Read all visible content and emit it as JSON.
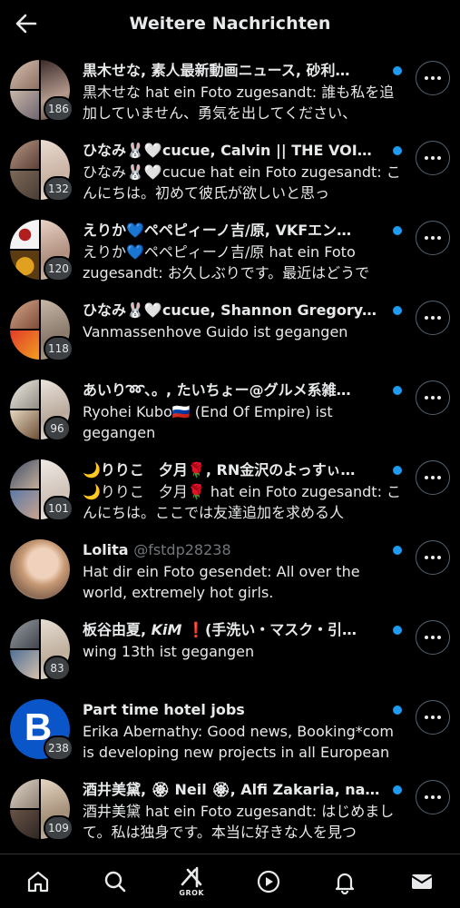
{
  "header": {
    "title": "Weitere Nachrichten"
  },
  "conversations": [
    {
      "title": "黒木せな, 素人最新動画ニュース, 砂利…",
      "handle": "",
      "preview": "黒木せな hat ein Foto zugesandt: 誰も私を追加していません、勇気を出してください、",
      "count": "186",
      "unread": true
    },
    {
      "title": "ひなみ🐰🤍cucue, Calvin || THE VOID…",
      "handle": "",
      "preview": "ひなみ🐰🤍cucue hat ein Foto zugesandt: こんにちは。初めて彼氏が欲しいと思っ",
      "count": "132",
      "unread": true
    },
    {
      "title": "えりか💙ペペピィーノ吉/原, VKFエン…",
      "handle": "",
      "preview": "えりか💙ペペピィーノ吉/原 hat ein Foto zugesandt: お久しぶりです。最近はどうで",
      "count": "120",
      "unread": true
    },
    {
      "title": "ひなみ🐰🤍cucue, Shannon Gregory, …",
      "handle": "",
      "preview": "Vanmassenhove Guido ist gegangen",
      "count": "118",
      "unread": true
    },
    {
      "title": "あいり➿︎︎、。, たいちょー@グルメ系雑…",
      "handle": "",
      "preview": "Ryohei Kubo🇷🇺 (End Of Empire) ist gegangen",
      "count": "96",
      "unread": true
    },
    {
      "title": "🌙りりこ　夕月🌹, RN金沢のよっすぃ…",
      "handle": "",
      "preview": "🌙りりこ　夕月🌹 hat ein Foto zugesandt: こんにちは。ここでは友達追加を求める人",
      "count": "101",
      "unread": true
    },
    {
      "title": "Lolita",
      "handle": "@fstdp28238",
      "preview": "Hat dir ein Foto gesendet: All over the world, extremely hot girls.",
      "count": "",
      "unread": true
    },
    {
      "title": "板谷由夏, 𝙆𝙞𝙈 ❗(手洗い・マスク・引…",
      "handle": "",
      "preview": "wing 13th ist gegangen",
      "count": "83",
      "unread": true
    },
    {
      "title": "Part time hotel jobs",
      "handle": "",
      "preview": "Erika Abernathy: Good news, Booking*com is developing new projects in all European",
      "count": "238",
      "unread": true
    },
    {
      "title": "酒井美黛, 🏵 Neil 🏵, Alfi Zakaria, nao…",
      "handle": "",
      "preview": "酒井美黛 hat ein Foto zugesandt: はじめまして。私は独身です。本当に好きな人を見つ",
      "count": "109",
      "unread": true
    }
  ],
  "bottom_nav": {
    "grok_label": "GROK"
  },
  "icons": [
    "arrow-left-icon",
    "more-icon",
    "home-icon",
    "search-icon",
    "grok-icon",
    "play-icon",
    "bell-icon",
    "mail-icon"
  ],
  "colors": {
    "accent": "#1d9bf0",
    "background": "#000000",
    "text": "#e7e9ea",
    "muted": "#71767b"
  }
}
